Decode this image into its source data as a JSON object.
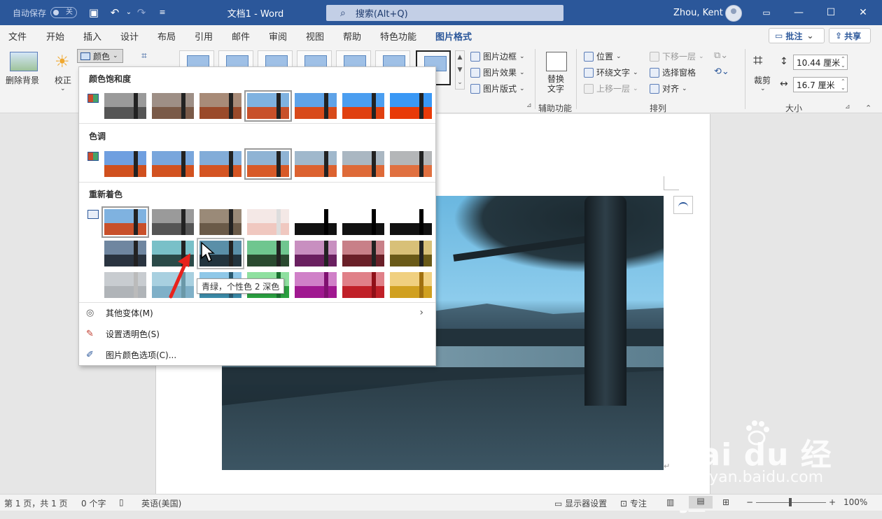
{
  "titlebar": {
    "autosave_label": "自动保存",
    "autosave_state": "关",
    "doc_title": "文档1  -  Word",
    "search_placeholder": "搜索(Alt+Q)",
    "user": "Zhou, Kent"
  },
  "tabs": [
    "文件",
    "开始",
    "插入",
    "设计",
    "布局",
    "引用",
    "邮件",
    "审阅",
    "视图",
    "帮助",
    "特色功能",
    "图片格式"
  ],
  "active_tab": "图片格式",
  "ribbon_right": {
    "comments": "批注",
    "share": "共享"
  },
  "ribbon": {
    "remove_bg": "删除背景",
    "corrections": "校正",
    "color": "颜色",
    "picture_border": "图片边框",
    "picture_effects": "图片效果",
    "picture_layout": "图片版式",
    "alt_text_1": "替换",
    "alt_text_2": "文字",
    "accessibility_group": "辅助功能",
    "position": "位置",
    "wrap_text": "环绕文字",
    "bring_forward": "上移一层",
    "send_backward": "下移一层",
    "selection_pane": "选择窗格",
    "align": "对齐",
    "arrange_group": "排列",
    "crop": "裁剪",
    "height": "10.44 厘米",
    "width": "16.7 厘米",
    "size_group": "大小"
  },
  "dropdown": {
    "saturation_title": "颜色饱和度",
    "tone_title": "色调",
    "recolor_title": "重新着色",
    "more_variations": "其他变体(M)",
    "set_transparent": "设置透明色(S)",
    "color_options": "图片颜色选项(C)...",
    "tooltip": "青绿，个性色 2 深色"
  },
  "statusbar": {
    "page": "第 1 页，共 1 页",
    "words": "0 个字",
    "language": "英语(美国)",
    "display_settings": "显示器设置",
    "focus": "专注",
    "zoom": "100%"
  },
  "watermark": {
    "brand": "Bai du 经验",
    "url": "jingyan.baidu.com"
  },
  "colors": {
    "accent": "#2b579a",
    "arrow": "#e8221c"
  }
}
